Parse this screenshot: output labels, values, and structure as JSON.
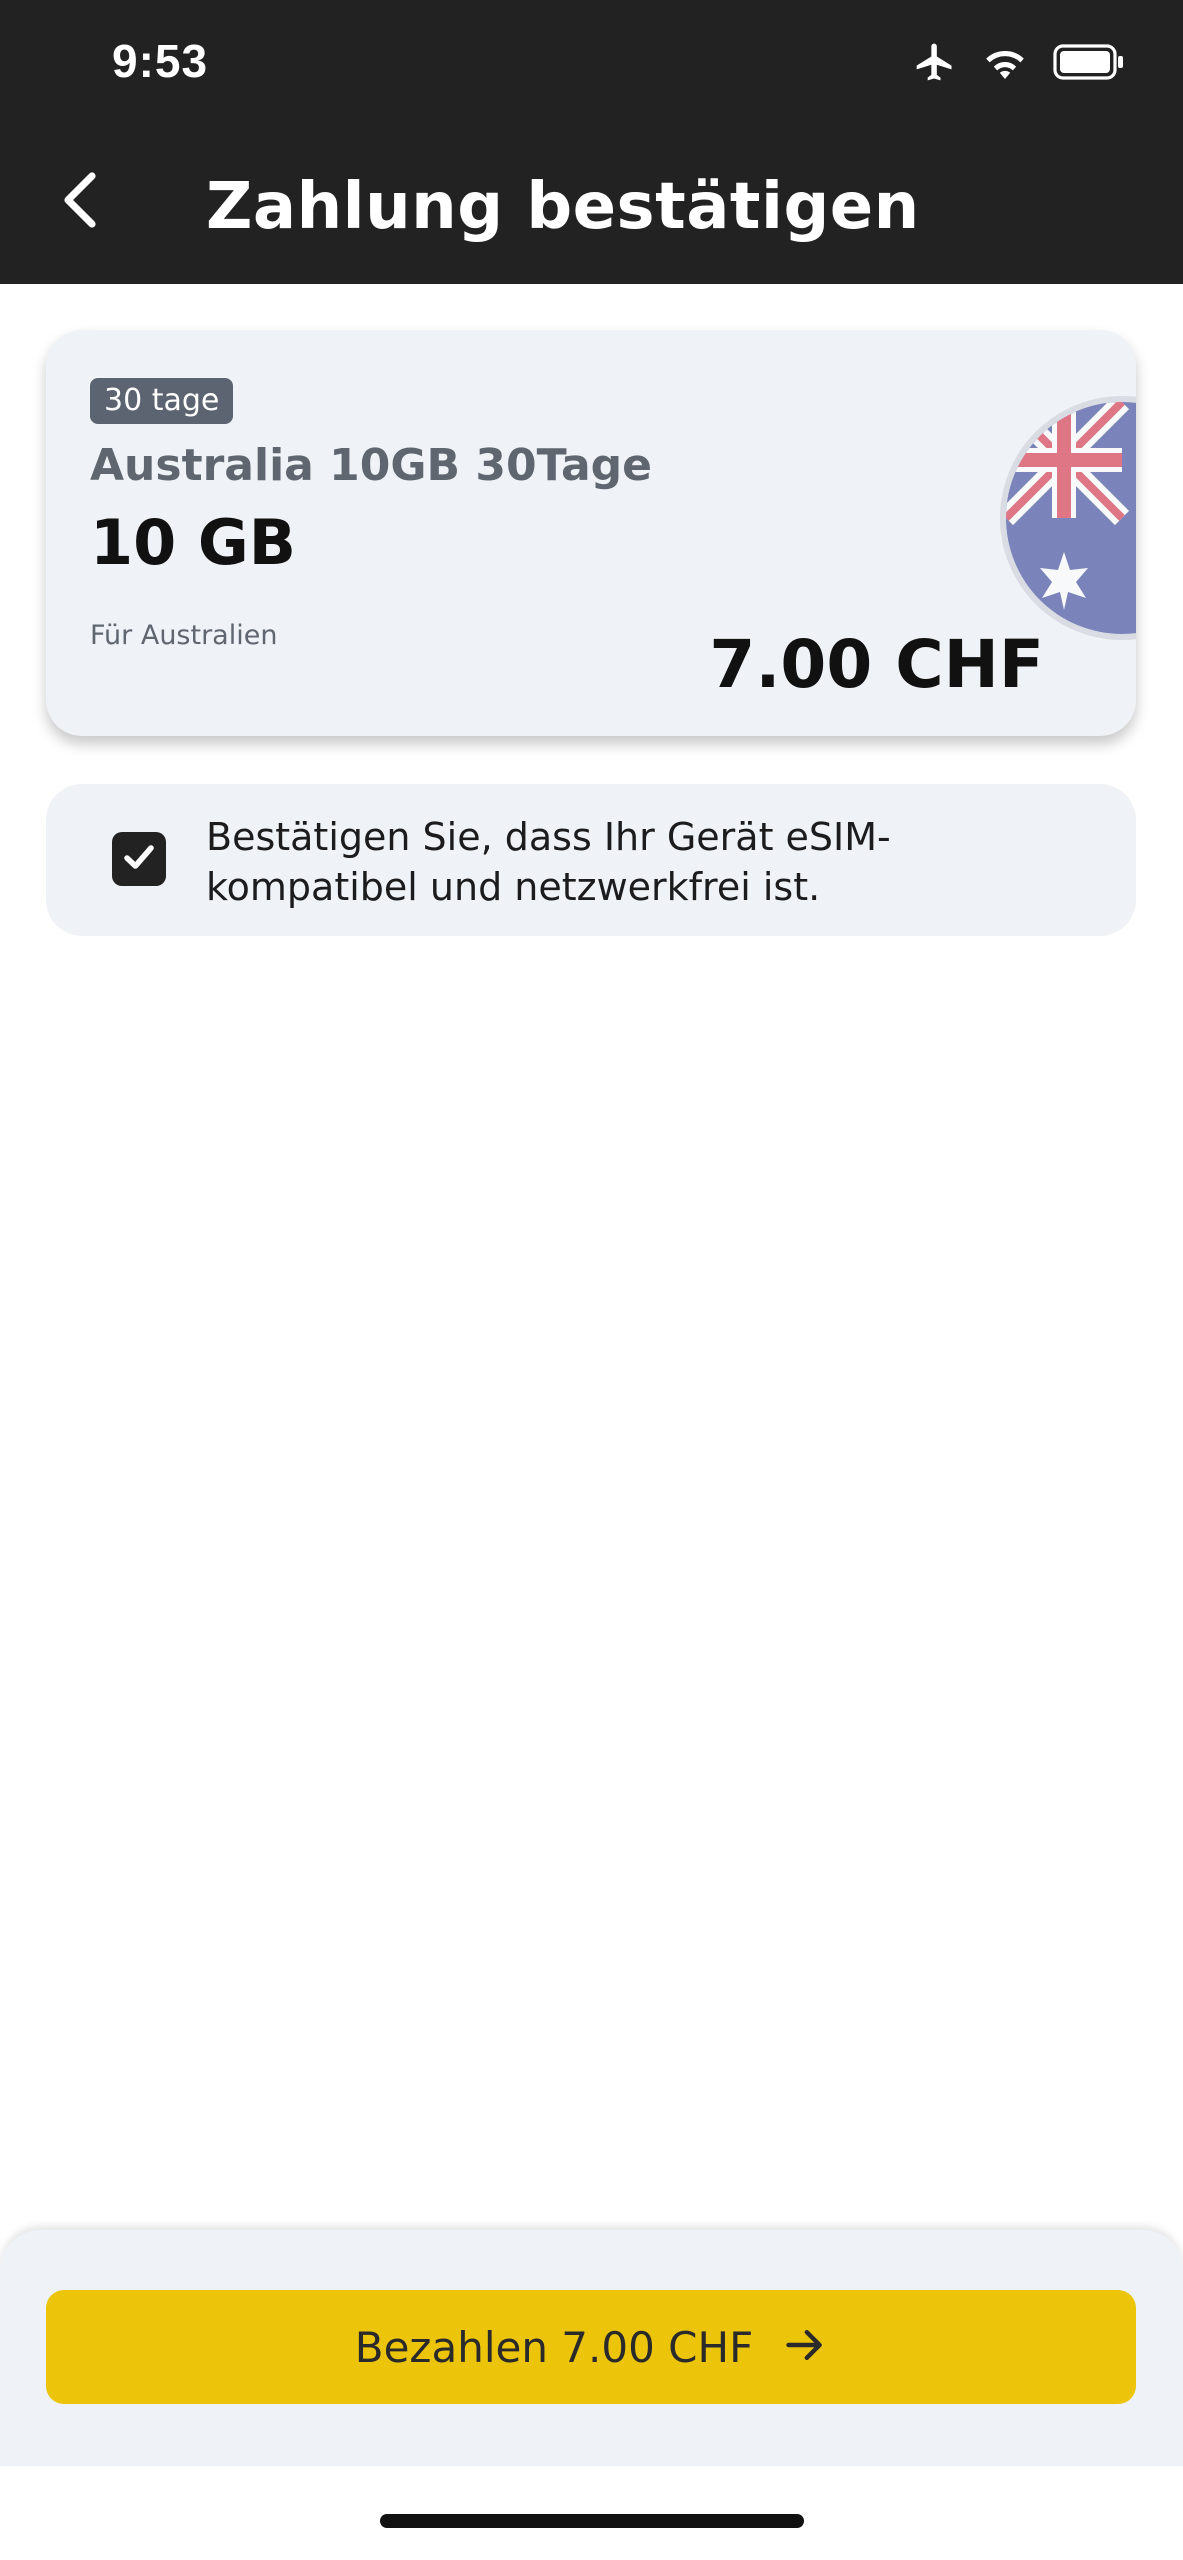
{
  "status_bar": {
    "time": "9:53",
    "icons": [
      "airplane-icon",
      "wifi-icon",
      "battery-icon"
    ]
  },
  "header": {
    "title": "Zahlung bestätigen",
    "back_icon": "chevron-left-icon"
  },
  "plan": {
    "days_badge": "30 tage",
    "name": "Australia 10GB 30Tage",
    "data_amount": "10 GB",
    "region": "Für Australien",
    "price": "7.00 CHF",
    "flag_icon": "australia-flag-icon"
  },
  "confirm": {
    "checked": true,
    "text": "Bestätigen Sie, dass Ihr Gerät eSIM-kompatibel und netzwerkfrei ist."
  },
  "pay_button": {
    "label": "Bezahlen 7.00 CHF",
    "icon": "arrow-right-icon"
  },
  "colors": {
    "header_bg": "#222222",
    "card_bg": "#eff2f6",
    "accent": "#ecc40a",
    "badge_bg": "#5b6470"
  }
}
